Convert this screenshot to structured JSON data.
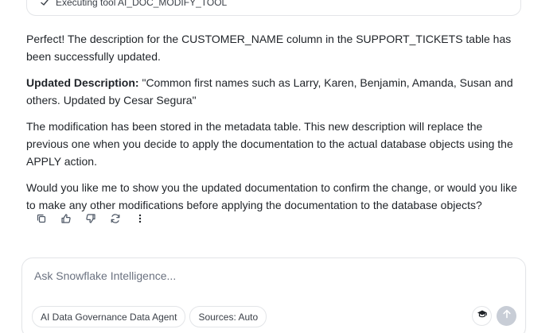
{
  "tool_card": {
    "status_text": "Executing tool AI_DOC_MODIFY_TOOL"
  },
  "message": {
    "para1": "Perfect! The description for the CUSTOMER_NAME column in the SUPPORT_TICKETS table has been successfully updated.",
    "para2_label": "Updated Description:",
    "para2_text": " \"Common first names such as Larry, Karen, Benjamin, Amanda, Susan and others. Updated by Cesar Segura\"",
    "para3": "The modification has been stored in the metadata table. This new description will replace the previous one when you decide to apply the documentation to the actual database objects using the APPLY action.",
    "para4": "Would you like me to show you the updated documentation to confirm the change, or would you like to make any other modifications before applying the documentation to the database objects?"
  },
  "actions": {
    "icons": [
      "copy-icon",
      "thumbs-up-icon",
      "thumbs-down-icon",
      "refresh-icon",
      "more-vertical-icon"
    ]
  },
  "composer": {
    "placeholder": "Ask Snowflake Intelligence...",
    "value": "",
    "chips": {
      "agent": "AI Data Governance Data Agent",
      "sources": "Sources: Auto"
    },
    "icons": {
      "cap": "graduation-cap-icon",
      "send": "arrow-up-icon"
    }
  },
  "colors": {
    "text": "#1f2328",
    "muted": "#6b7280",
    "border": "#e3e5e8",
    "send_bg": "#c8cdd6"
  }
}
